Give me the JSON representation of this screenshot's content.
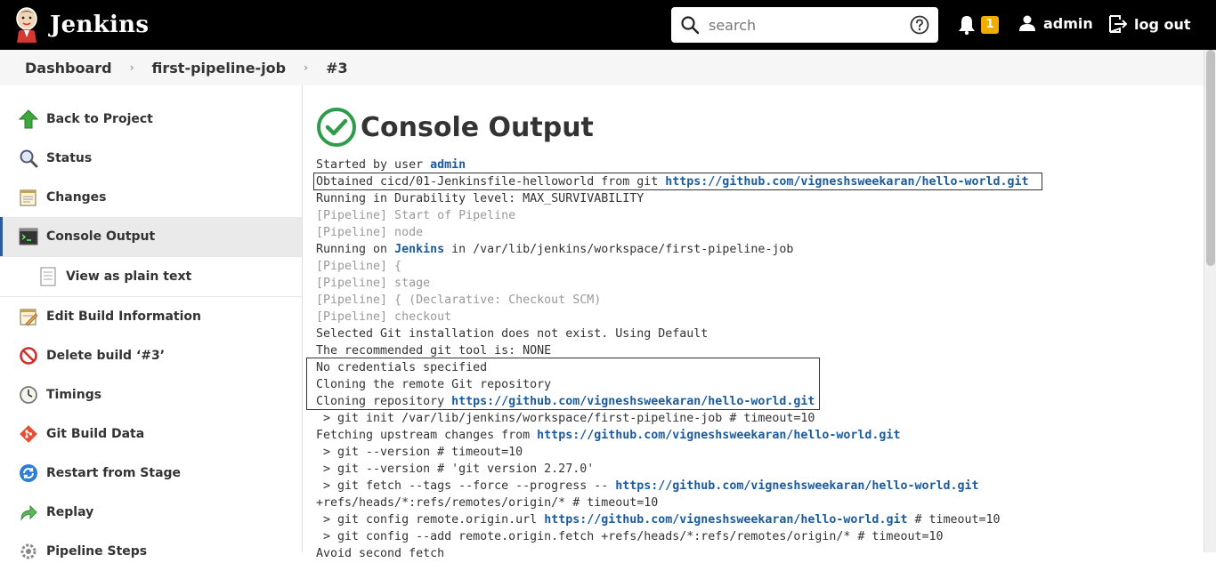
{
  "header": {
    "brand": "Jenkins",
    "search_placeholder": "search",
    "notification_count": "1",
    "user": "admin",
    "logout_label": "log out"
  },
  "breadcrumbs": [
    "Dashboard",
    "first-pipeline-job",
    "#3"
  ],
  "sidebar": {
    "items": [
      {
        "label": "Back to Project",
        "icon": "up-arrow-icon"
      },
      {
        "label": "Status",
        "icon": "magnifier-icon"
      },
      {
        "label": "Changes",
        "icon": "notepad-icon"
      },
      {
        "label": "Console Output",
        "icon": "terminal-icon"
      },
      {
        "label": "View as plain text",
        "icon": "document-icon"
      },
      {
        "label": "Edit Build Information",
        "icon": "notepad-edit-icon"
      },
      {
        "label": "Delete build ‘#3’",
        "icon": "no-entry-icon"
      },
      {
        "label": "Timings",
        "icon": "clock-icon"
      },
      {
        "label": "Git Build Data",
        "icon": "git-icon"
      },
      {
        "label": "Restart from Stage",
        "icon": "refresh-icon"
      },
      {
        "label": "Replay",
        "icon": "replay-arrow-icon"
      },
      {
        "label": "Pipeline Steps",
        "icon": "gear-icon"
      }
    ]
  },
  "main": {
    "title": "Console Output",
    "status_color": "#2e9c4a"
  },
  "console": {
    "l1": {
      "text": "Started by user ",
      "link": "admin"
    },
    "l2": {
      "text": "Obtained cicd/01-Jenkinsfile-helloworld from git ",
      "link": "https://github.com/vigneshsweekaran/hello-world.git"
    },
    "l3": "Running in Durability level: MAX_SURVIVABILITY",
    "l4": "[Pipeline] Start of Pipeline",
    "l5": "[Pipeline] node",
    "l6": {
      "text": "Running on ",
      "link": "Jenkins",
      "after": " in /var/lib/jenkins/workspace/first-pipeline-job"
    },
    "l7": "[Pipeline] {",
    "l8": "[Pipeline] stage",
    "l9": "[Pipeline] { (Declarative: Checkout SCM)",
    "l10": "[Pipeline] checkout",
    "l11": "Selected Git installation does not exist. Using Default",
    "l12": "The recommended git tool is: NONE",
    "l13": "No credentials specified",
    "l14": "Cloning the remote Git repository",
    "l15": {
      "text": "Cloning repository ",
      "link": "https://github.com/vigneshsweekaran/hello-world.git"
    },
    "l16": " > git init /var/lib/jenkins/workspace/first-pipeline-job # timeout=10",
    "l17": {
      "text": "Fetching upstream changes from ",
      "link": "https://github.com/vigneshsweekaran/hello-world.git"
    },
    "l18": " > git --version # timeout=10",
    "l19": " > git --version # 'git version 2.27.0'",
    "l20": {
      "text": " > git fetch --tags --force --progress -- ",
      "link": "https://github.com/vigneshsweekaran/hello-world.git"
    },
    "l21": "+refs/heads/*:refs/remotes/origin/* # timeout=10",
    "l22": {
      "text": " > git config remote.origin.url ",
      "link": "https://github.com/vigneshsweekaran/hello-world.git",
      "after": " # timeout=10"
    },
    "l23": " > git config --add remote.origin.fetch +refs/heads/*:refs/remotes/origin/* # timeout=10",
    "l24": "Avoid second fetch"
  }
}
